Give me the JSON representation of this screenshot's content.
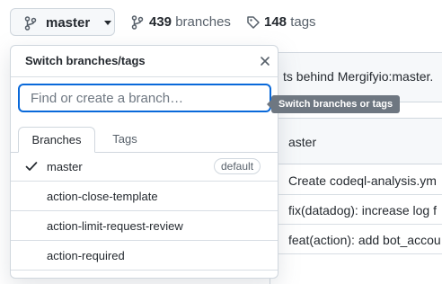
{
  "branch_button": {
    "label": "master",
    "icon": "git-branch-icon"
  },
  "stats": {
    "branches_count": "439",
    "branches_label": "branches",
    "tags_count": "148",
    "tags_label": "tags"
  },
  "background": {
    "behind_text": "ts behind Mergifyio:master.",
    "branch_row_text": "aster",
    "files": [
      "Create codeql-analysis.ym",
      "fix(datadog): increase log f",
      "feat(action): add bot_accou",
      ""
    ]
  },
  "dropdown": {
    "title": "Switch branches/tags",
    "search_placeholder": "Find or create a branch…",
    "tabs": [
      "Branches",
      "Tags"
    ],
    "items": [
      {
        "name": "master",
        "selected": true,
        "badge": "default"
      },
      {
        "name": "action-close-template",
        "selected": false,
        "badge": ""
      },
      {
        "name": "action-limit-request-review",
        "selected": false,
        "badge": ""
      },
      {
        "name": "action-required",
        "selected": false,
        "badge": ""
      }
    ]
  },
  "tooltip": "Switch branches or tags",
  "colors": {
    "accent": "#0969da",
    "tooltip_bg": "#6e7781",
    "border": "#d0d7de"
  }
}
